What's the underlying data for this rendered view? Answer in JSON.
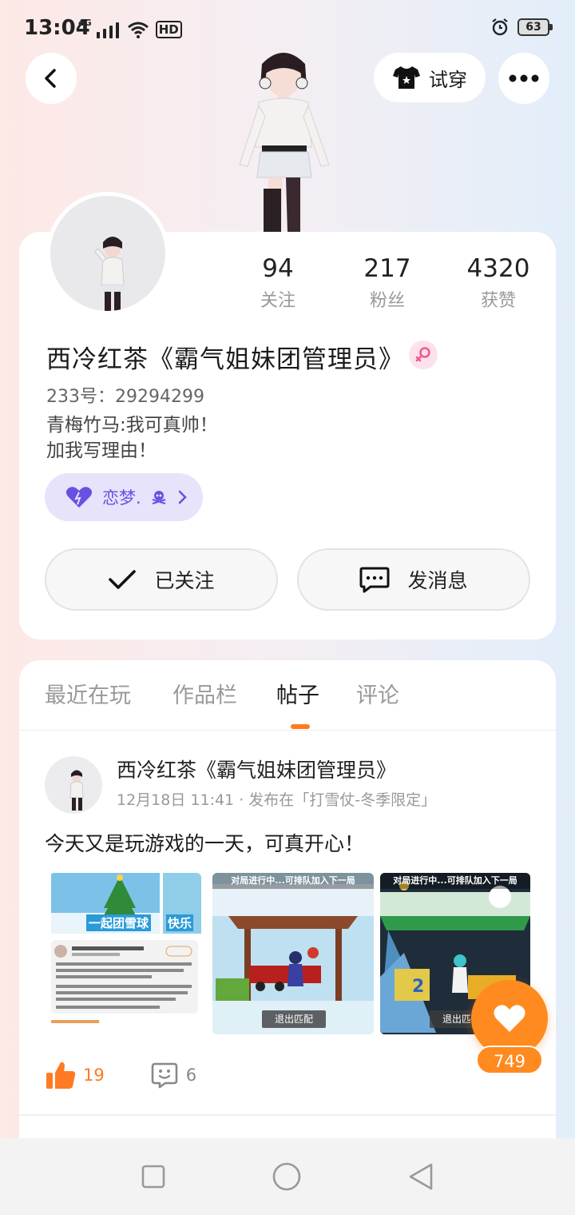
{
  "status_bar": {
    "time": "13:04",
    "network": "4G",
    "hd": "HD",
    "battery": "63"
  },
  "header": {
    "tryon_label": "试穿"
  },
  "profile": {
    "stats": [
      {
        "value": "94",
        "label": "关注"
      },
      {
        "value": "217",
        "label": "粉丝"
      },
      {
        "value": "4320",
        "label": "获赞"
      }
    ],
    "username": "西冷红茶《霸气姐妹团管理员》",
    "uid": "233号：29294299",
    "bio_line1": "青梅竹马:我可真帅！",
    "bio_line2": "加我写理由！",
    "love_tag": "恋梦.",
    "follow_label": "已关注",
    "message_label": "发消息"
  },
  "tabs": [
    {
      "label": "最近在玩"
    },
    {
      "label": "作品栏"
    },
    {
      "label": "帖子"
    },
    {
      "label": "评论"
    }
  ],
  "post": {
    "author": "西冷红茶《霸气姐妹团管理员》",
    "meta": "12月18日 11:41 · 发布在「打雪仗-冬季限定」",
    "text": "今天又是玩游戏的一天，可真开心！",
    "thumb1_banner": "一起团雪球",
    "thumb1_banner2": "快乐",
    "thumb2_title": "对局进行中...可排队加入下一局",
    "thumb2_exit": "退出匹配",
    "thumb3_title": "对局进行中...可排队加入下一局",
    "thumb3_exit": "退出匹配",
    "likes": "19",
    "comments": "6"
  },
  "floating": {
    "count": "749"
  },
  "colors": {
    "accent": "#ff7a22",
    "love_tag": "#6a4fe2"
  }
}
